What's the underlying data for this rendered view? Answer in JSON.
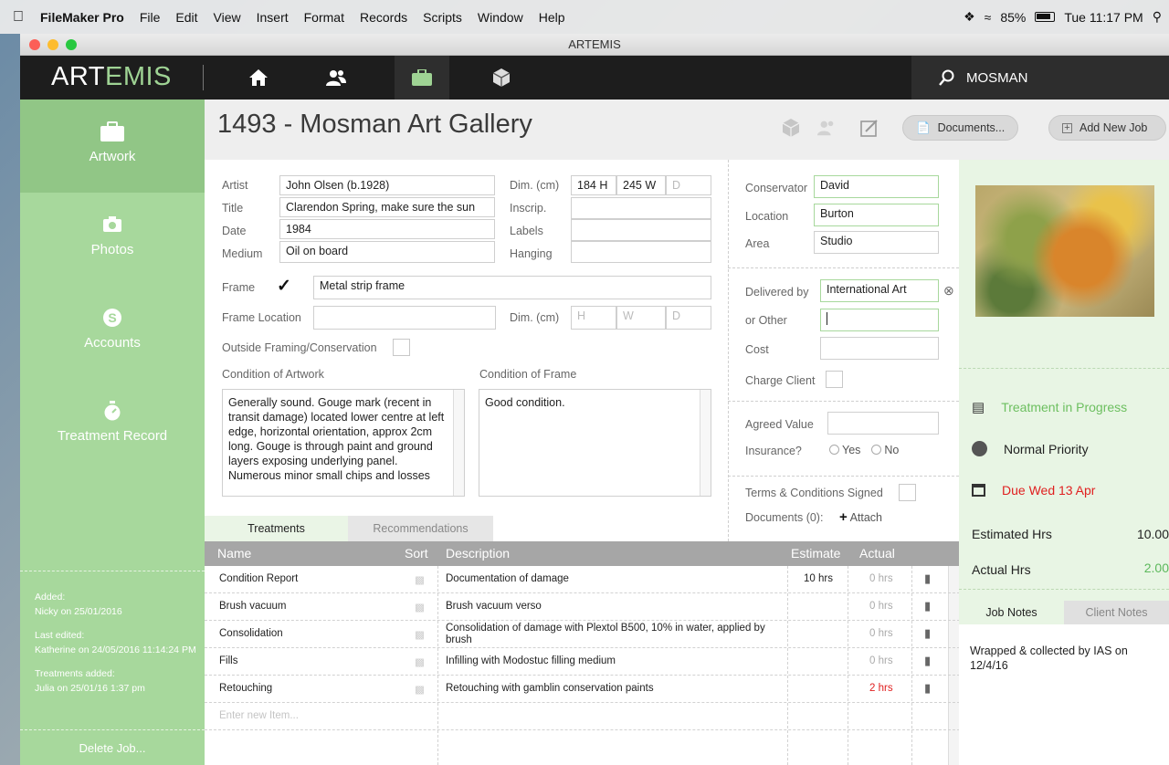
{
  "menubar": {
    "app": "FileMaker Pro",
    "items": [
      "File",
      "Edit",
      "View",
      "Insert",
      "Format",
      "Records",
      "Scripts",
      "Window",
      "Help"
    ],
    "battery": "85%",
    "clock": "Tue 11:17 PM"
  },
  "window": {
    "title": "ARTEMIS"
  },
  "logo": {
    "part1": "ART",
    "part2": "EMIS"
  },
  "search": {
    "value": "MOSMAN"
  },
  "sidebar": {
    "items": [
      {
        "label": "Artwork",
        "icon": "briefcase-icon"
      },
      {
        "label": "Photos",
        "icon": "camera-icon"
      },
      {
        "label": "Accounts",
        "icon": "dollar-icon"
      },
      {
        "label": "Treatment Record",
        "icon": "stopwatch-icon"
      }
    ],
    "meta": {
      "added_label": "Added:",
      "added_value": "Nicky on 25/01/2016",
      "edited_label": "Last edited:",
      "edited_value": "Katherine on 24/05/2016 11:14:24 PM",
      "treat_label": "Treatments added:",
      "treat_value": "Julia on 25/01/16 1:37 pm"
    },
    "delete": "Delete Job..."
  },
  "header": {
    "title": "1493 - Mosman Art Gallery",
    "documents_btn": "Documents...",
    "add_job_btn": "Add New Job"
  },
  "form": {
    "artist_label": "Artist",
    "artist": "John Olsen (b.1928)",
    "title_label": "Title",
    "title": "Clarendon Spring, make sure the sun",
    "date_label": "Date",
    "date": "1984",
    "medium_label": "Medium",
    "medium": "Oil on board",
    "dim_label": "Dim. (cm)",
    "dim_h": "184 H",
    "dim_w": "245 W",
    "dim_d": "D",
    "inscrip_label": "Inscrip.",
    "labels_label": "Labels",
    "hanging_label": "Hanging",
    "frame_label": "Frame",
    "frame_checked": "✓",
    "frame_value": "Metal strip frame",
    "frame_location_label": "Frame Location",
    "frame_dim_label": "Dim. (cm)",
    "fh": "H",
    "fw": "W",
    "fd": "D",
    "outside_label": "Outside Framing/Conservation",
    "cond_art_label": "Condition of Artwork",
    "cond_art": "Generally sound. Gouge mark (recent in transit damage) located lower centre at left edge, horizontal orientation, approx 2cm long. Gouge is through paint and ground layers exposing underlying panel. Numerous minor small chips and losses",
    "cond_frame_label": "Condition of Frame",
    "cond_frame": "Good condition.",
    "conservator_label": "Conservator",
    "conservator": "David",
    "location_label": "Location",
    "location": "Burton",
    "area_label": "Area",
    "area": "Studio",
    "delivered_label": "Delivered by",
    "delivered": "International Art",
    "other_label": "or Other",
    "cost_label": "Cost",
    "charge_label": "Charge Client",
    "agreed_label": "Agreed Value",
    "insurance_label": "Insurance?",
    "yes": "Yes",
    "no": "No",
    "terms_label": "Terms & Conditions Signed",
    "docs_label": "Documents (0):",
    "attach": "Attach"
  },
  "tabs": {
    "treatments": "Treatments",
    "recommendations": "Recommendations"
  },
  "table": {
    "headers": {
      "name": "Name",
      "sort": "Sort",
      "description": "Description",
      "estimate": "Estimate",
      "actual": "Actual"
    },
    "rows": [
      {
        "name": "Condition Report",
        "desc": "Documentation of damage",
        "est": "10 hrs",
        "act": "0 hrs"
      },
      {
        "name": "Brush vacuum",
        "desc": "Brush vacuum verso",
        "est": "",
        "act": "0 hrs"
      },
      {
        "name": "Consolidation",
        "desc": "Consolidation of damage with Plextol B500, 10% in water, applied by brush",
        "est": "",
        "act": "0 hrs"
      },
      {
        "name": "Fills",
        "desc": "Infilling with Modostuc filling medium",
        "est": "",
        "act": "0 hrs"
      },
      {
        "name": "Retouching",
        "desc": "Retouching with gamblin conservation paints",
        "est": "",
        "act": "2 hrs"
      }
    ],
    "new_item_placeholder": "Enter new Item..."
  },
  "status": {
    "treatment": "Treatment in Progress",
    "priority": "Normal Priority",
    "due": "Due Wed 13 Apr",
    "est_label": "Estimated Hrs",
    "est_value": "10.00",
    "act_label": "Actual Hrs",
    "act_value": "2.00"
  },
  "notes": {
    "tab_job": "Job Notes",
    "tab_client": "Client Notes",
    "text": "Wrapped & collected by IAS on 12/4/16"
  },
  "colors": {
    "accent": "#a7d89c",
    "accent_text": "#5cb85c",
    "red": "#e02020",
    "nav": "#1d1d1d"
  }
}
